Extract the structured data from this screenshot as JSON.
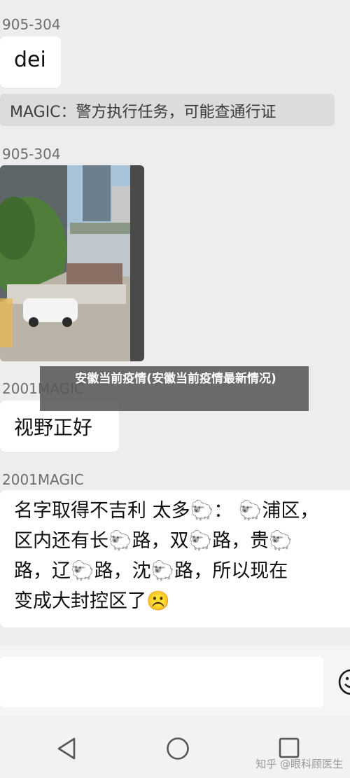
{
  "messages": {
    "m1_sender": "905-304",
    "m1_text": "dei",
    "notice_text": "MAGIC：警方执行任务，可能查通行证",
    "m2_sender": "905-304",
    "m3_sender": "2001MAGIC",
    "m3_text": "视野正好",
    "m4_sender": "2001MAGIC",
    "m4_lines": [
      "名字取得不吉利 太多🐑： 🐑浦区，",
      "区内还有长🐑路，双🐑路，贵🐑",
      "路，辽🐑路，沈🐑路，所以现在",
      "变成大封控区了☹️"
    ]
  },
  "overlay_title": "安徽当前疫情(安徽当前疫情最新情况)",
  "input": {
    "emoji_button_icon": "smiley-face-icon"
  },
  "nav": {
    "back_icon": "triangle-back-icon",
    "home_icon": "circle-home-icon",
    "recents_icon": "square-recents-icon"
  },
  "watermark": "知乎 @眼科顾医生",
  "colors": {
    "background": "#ededed",
    "bubble": "#ffffff",
    "notice_bg": "#dcdcdc",
    "overlay_bg": "#585858"
  }
}
